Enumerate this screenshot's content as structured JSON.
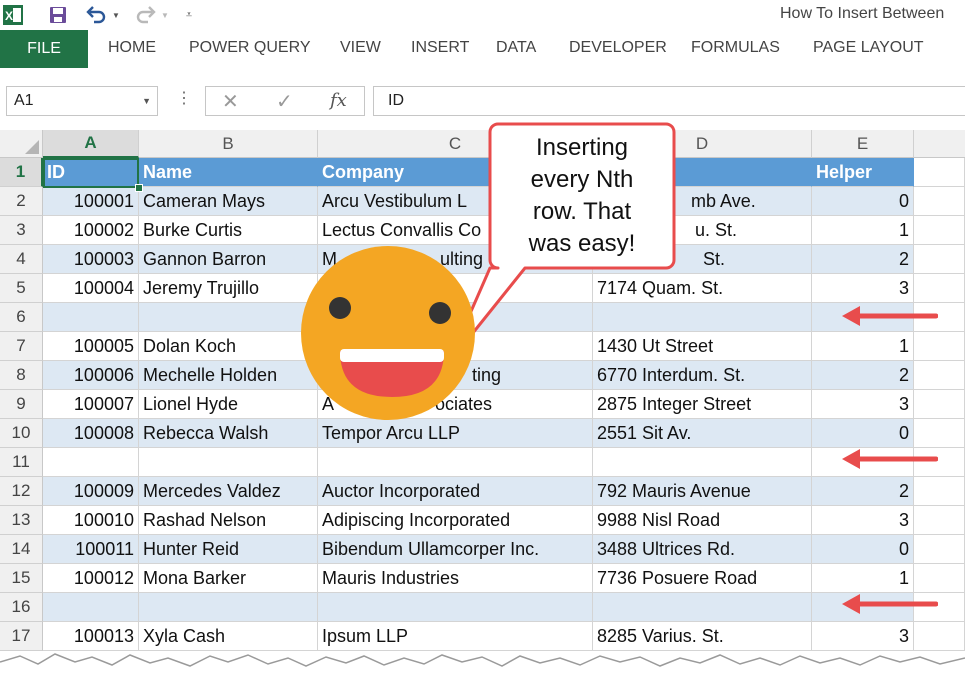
{
  "window": {
    "title": "How To Insert Between"
  },
  "quick_access": {
    "app_icon": "excel-icon",
    "save_icon": "save-icon",
    "undo_icon": "undo-icon",
    "redo_icon": "redo-icon",
    "customize_icon": "customize-icon"
  },
  "ribbon": {
    "file_label": "FILE",
    "tabs": [
      "HOME",
      "POWER QUERY",
      "VIEW",
      "INSERT",
      "DATA",
      "DEVELOPER",
      "FORMULAS",
      "PAGE LAYOUT"
    ]
  },
  "formula_bar": {
    "name_box": "A1",
    "cancel_icon": "close-icon",
    "enter_icon": "checkmark-icon",
    "fx_label": "fx",
    "formula": "ID"
  },
  "grid": {
    "columns": [
      "A",
      "B",
      "C",
      "D",
      "E"
    ],
    "selected_column": "A",
    "selected_row": "1",
    "headers": [
      "ID",
      "Name",
      "Company",
      "",
      "Helper"
    ],
    "rows": [
      {
        "n": "2",
        "id": "100001",
        "name": "Cameran Mays",
        "company": "Arcu Vestibulum L",
        "address": "mb Ave.",
        "helper": "0"
      },
      {
        "n": "3",
        "id": "100002",
        "name": "Burke Curtis",
        "company": "Lectus Convallis Co",
        "address": "u. St.",
        "helper": "1"
      },
      {
        "n": "4",
        "id": "100003",
        "name": "Gannon Barron",
        "company": "M",
        "company2": "ulting",
        "address": "St.",
        "helper": "2"
      },
      {
        "n": "5",
        "id": "100004",
        "name": "Jeremy Trujillo",
        "company": "",
        "address": "7174 Quam. St.",
        "helper": "3"
      },
      {
        "n": "6",
        "id": "",
        "name": "",
        "company": "",
        "address": "",
        "helper": ""
      },
      {
        "n": "7",
        "id": "100005",
        "name": "Dolan Koch",
        "company": "",
        "address": "1430 Ut Street",
        "helper": "1"
      },
      {
        "n": "8",
        "id": "100006",
        "name": "Mechelle Holden",
        "company": "",
        "company2": "ting",
        "address": "6770 Interdum. St.",
        "helper": "2"
      },
      {
        "n": "9",
        "id": "100007",
        "name": "Lionel Hyde",
        "company": "A",
        "company2": "ociates",
        "address": "2875 Integer Street",
        "helper": "3"
      },
      {
        "n": "10",
        "id": "100008",
        "name": "Rebecca Walsh",
        "company": "Tempor Arcu LLP",
        "address": "2551 Sit Av.",
        "helper": "0"
      },
      {
        "n": "11",
        "id": "",
        "name": "",
        "company": "",
        "address": "",
        "helper": ""
      },
      {
        "n": "12",
        "id": "100009",
        "name": "Mercedes Valdez",
        "company": "Auctor Incorporated",
        "address": "792 Mauris Avenue",
        "helper": "2"
      },
      {
        "n": "13",
        "id": "100010",
        "name": "Rashad Nelson",
        "company": "Adipiscing Incorporated",
        "address": "9988 Nisl Road",
        "helper": "3"
      },
      {
        "n": "14",
        "id": "100011",
        "name": "Hunter Reid",
        "company": "Bibendum Ullamcorper Inc.",
        "address": "3488 Ultrices Rd.",
        "helper": "0"
      },
      {
        "n": "15",
        "id": "100012",
        "name": "Mona Barker",
        "company": "Mauris Industries",
        "address": "7736 Posuere Road",
        "helper": "1"
      },
      {
        "n": "16",
        "id": "",
        "name": "",
        "company": "",
        "address": "",
        "helper": ""
      },
      {
        "n": "17",
        "id": "100013",
        "name": "Xyla Cash",
        "company": "Ipsum LLP",
        "address": "8285 Varius. St.",
        "helper": "3"
      }
    ]
  },
  "overlay": {
    "callout_lines": [
      "Inserting",
      "every Nth",
      "row. That",
      "was easy!"
    ],
    "smiley_icon": "smiley-face-icon",
    "arrow_icon": "arrow-left-icon"
  },
  "colors": {
    "excel_green": "#217346",
    "table_header": "#5b9bd5",
    "band": "#dde8f3",
    "arrow": "#e84c4c",
    "smiley": "#f4a623",
    "mouth": "#e84c4c",
    "callout_border": "#e84c4c"
  }
}
